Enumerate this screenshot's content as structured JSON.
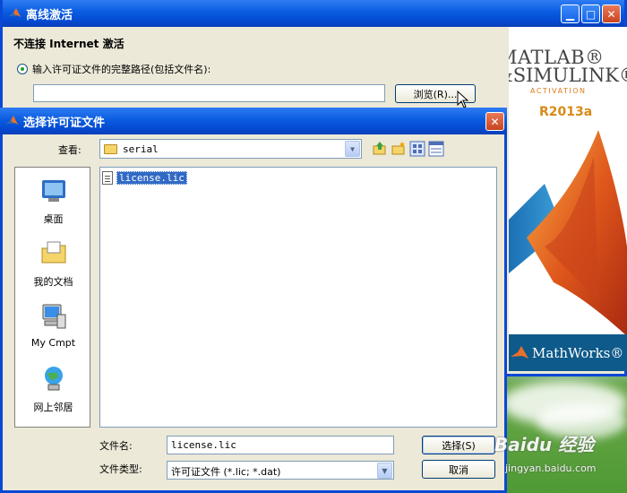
{
  "outer_window": {
    "title": "离线激活",
    "not_connected_label": "不连接 Internet 激活",
    "radio_label": "输入许可证文件的完整路径(包括文件名):",
    "path_value": "",
    "browse_label": "浏览(R)..."
  },
  "brand": {
    "line1": "MATLAB®",
    "line2": "&SIMULINK®",
    "activation": "ACTIVATION",
    "release": "R2013a",
    "company": "MathWorks®"
  },
  "dialog": {
    "title": "选择许可证文件",
    "look_in_label": "查看:",
    "look_in_value": "serial",
    "places": [
      {
        "label": "桌面",
        "icon": "desktop-icon"
      },
      {
        "label": "我的文档",
        "icon": "my-documents-icon"
      },
      {
        "label": "My Cmpt",
        "icon": "my-computer-icon"
      },
      {
        "label": "网上邻居",
        "icon": "network-places-icon"
      }
    ],
    "files": [
      {
        "name": "license.lic",
        "selected": true
      }
    ],
    "file_name_label": "文件名:",
    "file_name_value": "license.lic",
    "file_type_label": "文件类型:",
    "file_type_value": "许可证文件 (*.lic; *.dat)",
    "select_label": "选择(S)",
    "cancel_label": "取消"
  },
  "watermark": {
    "brand": "Baidu 经验",
    "url": "jingyan.baidu.com"
  },
  "colors": {
    "titlebar": "#0a5ce0",
    "selection": "#316ac5",
    "dialog_bg": "#ece9d8"
  }
}
